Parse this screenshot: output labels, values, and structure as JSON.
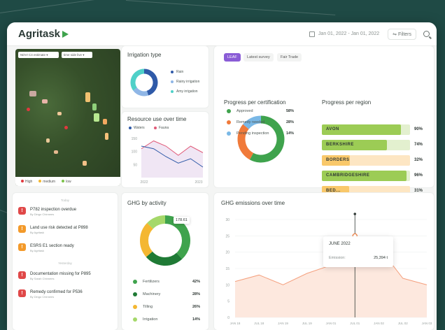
{
  "header": {
    "logo": "Agritask",
    "date_range": "Jan 01, 2022 - Jan 01, 2022",
    "filters_label": "Filters",
    "search_icon": "search-icon"
  },
  "map": {
    "layer_select": "NDVI C4 estimate",
    "time_select": "time side live",
    "legend": [
      {
        "label": "High",
        "color": "#e0393e"
      },
      {
        "label": "medium",
        "color": "#f4b731"
      },
      {
        "label": "low",
        "color": "#7cc24a"
      }
    ]
  },
  "notifications": {
    "today_label": "Today",
    "yesterday_label": "Yesterday",
    "items": [
      {
        "title": "P782 inspection overdue",
        "sub": "By Dingo Chinnees",
        "color": "#e04848",
        "icon": "clock-icon"
      },
      {
        "title": "Land use risk detected at P898",
        "sub": "By Agritask",
        "color": "#f39a2a",
        "icon": "alert-icon"
      },
      {
        "title": "ESRS E1 section ready",
        "sub": "By Agritask",
        "color": "#f39a2a",
        "icon": "file-icon"
      },
      {
        "title": "Documentation missing for P895",
        "sub": "By Sarah Chinnees",
        "color": "#e04848",
        "icon": "warning-icon"
      },
      {
        "title": "Remedy confirmed for P536",
        "sub": "By Dingo Chinnees",
        "color": "#e04848",
        "icon": "check-icon"
      }
    ]
  },
  "irrigation": {
    "title": "Irrigation type",
    "legend": [
      {
        "label": "Rain",
        "color": "#2f5aa8"
      },
      {
        "label": "Rainy irrigation",
        "color": "#8fb6e6"
      },
      {
        "label": "Amy irrigation",
        "color": "#4fd0c8"
      }
    ],
    "values": [
      0.45,
      0.2,
      0.35
    ]
  },
  "resource": {
    "title": "Resource use over time",
    "legend": [
      {
        "label": "Waters",
        "color": "#2f5aa8"
      },
      {
        "label": "Fauna",
        "color": "#e05a78"
      }
    ],
    "yticks": [
      "150",
      "100",
      "50"
    ],
    "xticks": [
      "2022",
      "2023"
    ],
    "series_a": [
      120,
      110,
      80,
      55,
      72,
      40
    ],
    "series_b": [
      110,
      140,
      120,
      85,
      120,
      95
    ]
  },
  "ghg_activity": {
    "title": "GHG by activity",
    "callout": "178.61",
    "rows": [
      {
        "label": "Fertilizers",
        "pct": "42%",
        "color": "#3fa34d",
        "value": 42
      },
      {
        "label": "Machinery",
        "pct": "28%",
        "color": "#1f7a35",
        "value": 28
      },
      {
        "label": "Tilling",
        "pct": "26%",
        "color": "#f4b731",
        "value": 26
      },
      {
        "label": "Irrigation",
        "pct": "14%",
        "color": "#a5d86a",
        "value": 14
      }
    ]
  },
  "certification": {
    "tabs": [
      "LEAF",
      "Latest survey",
      "Fair Trade"
    ],
    "title_left": "Progress per certification",
    "title_right": "Progress per region",
    "donut": [
      {
        "label": "Approved",
        "pct": "58%",
        "color": "#3fa34d",
        "value": 58
      },
      {
        "label": "Remedy needed",
        "pct": "28%",
        "color": "#f07a3a",
        "value": 28
      },
      {
        "label": "Pending inspection",
        "pct": "14%",
        "color": "#7ab8e6",
        "value": 14
      }
    ],
    "regions": [
      {
        "name": "AVON",
        "pct": "90%",
        "value": 0.9,
        "fill": "#9ccc55",
        "track": "#e3f0cf"
      },
      {
        "name": "BERKSHIRE",
        "pct": "74%",
        "value": 0.74,
        "fill": "#9ccc55",
        "track": "#e3f0cf"
      },
      {
        "name": "BORDERS",
        "pct": "32%",
        "value": 0.32,
        "fill": "#f9c86a",
        "track": "#fde6c3"
      },
      {
        "name": "CAMBRIDGESHIRE",
        "pct": "96%",
        "value": 0.96,
        "fill": "#9ccc55",
        "track": "#e3f0cf"
      },
      {
        "name": "BED...",
        "pct": "31%",
        "value": 0.31,
        "fill": "#f9c86a",
        "track": "#fde6c3"
      }
    ]
  },
  "emissions": {
    "title": "GHG emissions over time",
    "yticks": [
      "30",
      "25",
      "20",
      "15",
      "10",
      "5",
      "0"
    ],
    "xticks": [
      "JAN 18",
      "JUL 18",
      "JAN 19",
      "JUL 19",
      "JAN 01",
      "JUL 01",
      "JAN 02",
      "JUL 02",
      "JAN 03"
    ],
    "values": [
      11,
      13,
      10,
      13.5,
      16,
      25,
      21.5,
      12,
      10
    ],
    "tooltip_title": "JUNE 2022",
    "tooltip_label": "Emission:",
    "tooltip_value": "25,394 t"
  }
}
